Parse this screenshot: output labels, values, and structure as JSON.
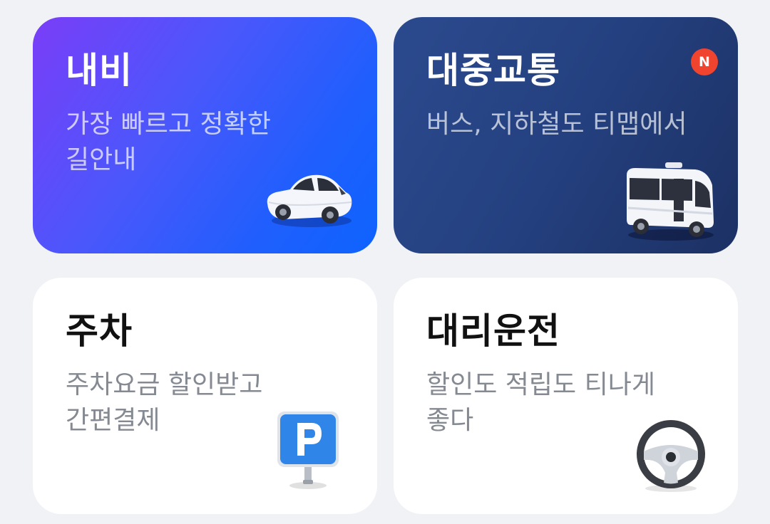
{
  "cards": {
    "navi": {
      "title": "내비",
      "desc_line1": "가장 빠르고 정확한",
      "desc_line2": "길안내",
      "icon": "car-icon"
    },
    "transit": {
      "title": "대중교통",
      "desc_line1": "버스, 지하철도 티맵에서",
      "badge": "N",
      "icon": "bus-icon"
    },
    "parking": {
      "title": "주차",
      "desc_line1": "주차요금 할인받고",
      "desc_line2": "간편결제",
      "icon": "parking-sign-icon"
    },
    "driver": {
      "title": "대리운전",
      "desc_line1": "할인도 적립도 티나게",
      "desc_line2": "좋다",
      "icon": "steering-wheel-icon"
    }
  },
  "colors": {
    "navi_gradient_start": "#7a3df8",
    "navi_gradient_end": "#0e63ff",
    "transit_bg": "#24407f",
    "badge": "#f0442f",
    "page_bg": "#f1f2f5"
  }
}
